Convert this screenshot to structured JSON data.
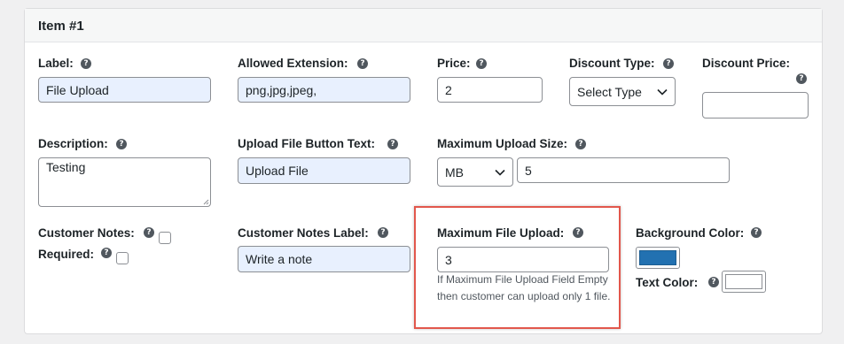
{
  "panel": {
    "title": "Item #1"
  },
  "fields": {
    "label": {
      "label": "Label:",
      "value": "File Upload"
    },
    "allowed_extension": {
      "label": "Allowed Extension:",
      "value": "png,jpg,jpeg,"
    },
    "price": {
      "label": "Price:",
      "value": "2"
    },
    "discount_type": {
      "label": "Discount Type:",
      "selected": "Select Type"
    },
    "discount_price": {
      "label": "Discount Price:",
      "value": ""
    },
    "description": {
      "label": "Description:",
      "value": "Testing"
    },
    "upload_button_text": {
      "label": "Upload File Button Text:",
      "value": "Upload File"
    },
    "max_upload_size": {
      "label": "Maximum Upload Size:",
      "unit": "MB",
      "value": "5"
    },
    "customer_notes": {
      "label": "Customer Notes:",
      "required_label": "Required:",
      "checked": false,
      "required_checked": false
    },
    "customer_notes_label": {
      "label": "Customer Notes Label:",
      "value": "Write a note"
    },
    "max_file_upload": {
      "label": "Maximum File Upload:",
      "value": "3",
      "note": "If Maximum File Upload Field Empty then customer can upload only 1 file."
    },
    "background_color": {
      "label": "Background Color:",
      "value": "#2271b1"
    },
    "text_color": {
      "label": "Text Color:",
      "value": "#ffffff"
    }
  },
  "icons": {
    "help": "?"
  },
  "colors": {
    "highlight": "#e2574c",
    "autofill": "#e8f0fe"
  }
}
